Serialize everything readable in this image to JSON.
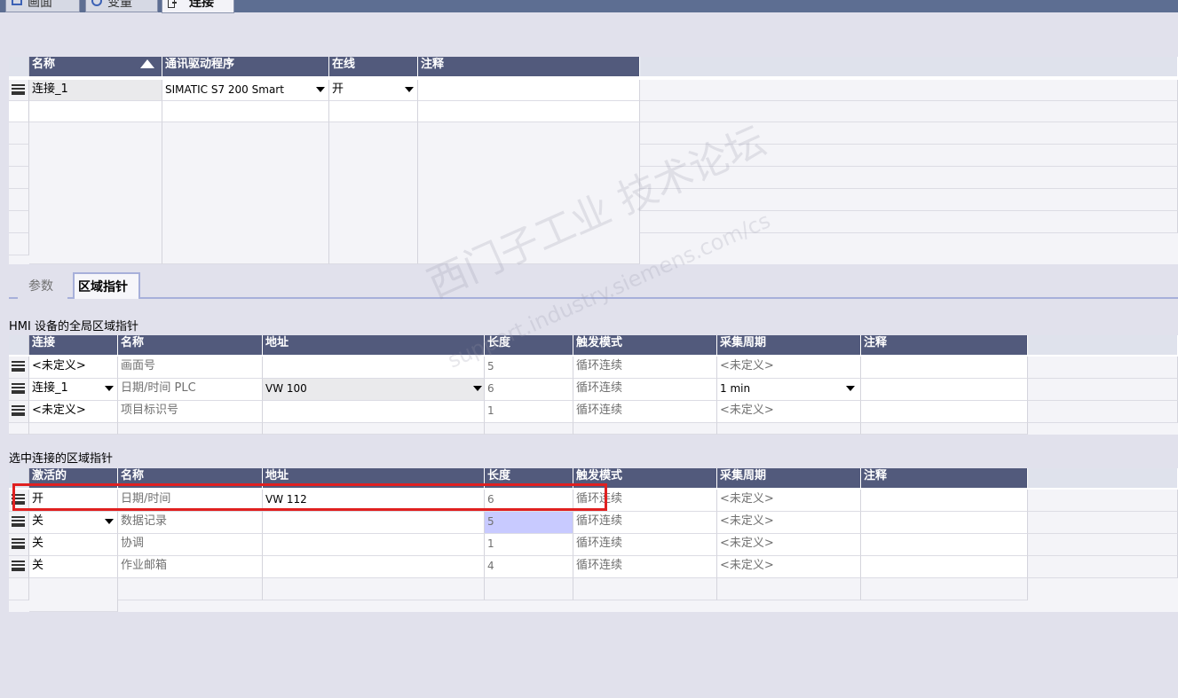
{
  "editor_tabs": [
    {
      "label": "画面",
      "icon": "screen-icon"
    },
    {
      "label": "变量",
      "icon": "variable-icon"
    },
    {
      "label": "连接",
      "icon": "connection-icon"
    }
  ],
  "connections": {
    "columns": [
      "名称",
      "通讯驱动程序",
      "在线",
      "注释"
    ],
    "rows": [
      {
        "name": "连接_1",
        "driver": "SIMATIC S7 200 Smart",
        "online": "开",
        "comment": ""
      }
    ]
  },
  "param_tabs": [
    {
      "label": "参数"
    },
    {
      "label": "区域指针"
    }
  ],
  "global_area": {
    "title": "HMI 设备的全局区域指针",
    "columns": [
      "连接",
      "名称",
      "地址",
      "长度",
      "触发模式",
      "采集周期",
      "注释"
    ],
    "rows": [
      {
        "connection": "<未定义>",
        "name": "画面号",
        "address": "",
        "length": "5",
        "trigger": "循环连续",
        "cycle": "<未定义>",
        "comment": ""
      },
      {
        "connection": "连接_1",
        "name": "日期/时间 PLC",
        "address": "VW 100",
        "length": "6",
        "trigger": "循环连续",
        "cycle": "1 min",
        "comment": ""
      },
      {
        "connection": "<未定义>",
        "name": "项目标识号",
        "address": "",
        "length": "1",
        "trigger": "循环连续",
        "cycle": "<未定义>",
        "comment": ""
      }
    ]
  },
  "selected_area": {
    "title": "选中连接的区域指针",
    "columns": [
      "激活的",
      "名称",
      "地址",
      "长度",
      "触发模式",
      "采集周期",
      "注释"
    ],
    "rows": [
      {
        "active": "开",
        "name": "日期/时间",
        "address": "VW 112",
        "length": "6",
        "trigger": "循环连续",
        "cycle": "<未定义>",
        "comment": ""
      },
      {
        "active": "关",
        "name": "数据记录",
        "address": "",
        "length": "5",
        "trigger": "循环连续",
        "cycle": "<未定义>",
        "comment": ""
      },
      {
        "active": "关",
        "name": "协调",
        "address": "",
        "length": "1",
        "trigger": "循环连续",
        "cycle": "<未定义>",
        "comment": ""
      },
      {
        "active": "关",
        "name": "作业邮箱",
        "address": "",
        "length": "4",
        "trigger": "循环连续",
        "cycle": "<未定义>",
        "comment": ""
      }
    ]
  },
  "watermark": {
    "line1": "西门子工业 技术论坛",
    "line2": "support.industry.siemens.com/cs"
  },
  "colors": {
    "header_bg": "#525a7c",
    "highlight": "#e02020",
    "selected_cell": "#c8caff"
  }
}
